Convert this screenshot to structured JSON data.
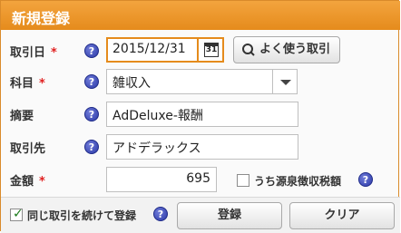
{
  "header": {
    "title": "新規登録"
  },
  "fields": {
    "date": {
      "label": "取引日",
      "required": "*",
      "value": "2015/12/31",
      "calendar_day": "31"
    },
    "often_used_button": {
      "label": "よく使う取引"
    },
    "category": {
      "label": "科目",
      "required": "*",
      "value": "雑収入"
    },
    "memo": {
      "label": "摘要",
      "value": "AdDeluxe-報酬"
    },
    "partner": {
      "label": "取引先",
      "value": "アドデラックス"
    },
    "amount": {
      "label": "金額",
      "required": "*",
      "value": "695"
    },
    "withholding": {
      "label": "うち源泉徴収税額",
      "checked": false
    }
  },
  "footer": {
    "continue_label": "同じ取引を続けて登録",
    "continue_checked": true,
    "register_button": "登録",
    "clear_button": "クリア"
  },
  "icons": {
    "help": "question-mark-icon",
    "calendar": "calendar-icon",
    "search": "magnifier-icon",
    "dropdown": "chevron-down-icon"
  },
  "colors": {
    "accent": "#e58b1c",
    "required": "#e02020",
    "help_icon": "#2c3aa8"
  }
}
